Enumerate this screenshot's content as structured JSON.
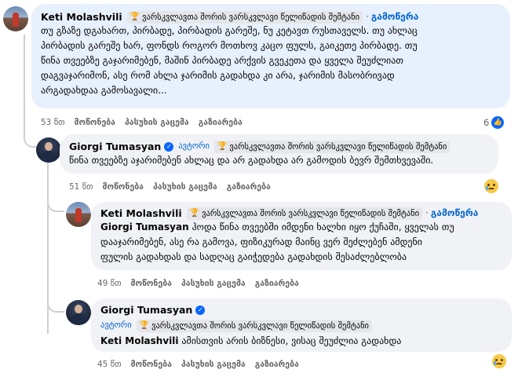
{
  "comments": [
    {
      "author": "Keti Molashvili",
      "badge": "ვარსკვლავთა შორის ვარსკვლავი წელიწადის შემტანი",
      "follow": "გამოწერა",
      "lines": [
        "თუ გზაზე დგახართ, პირბადე, პირბადის გარეშე, ნუ კეტავთ რუსთაველს. თუ ახლაც",
        "პირბადის გარეშე ხარ, ფონდს როგორ მოთხოვ კაცო ფულს, გაიკეთე პირბადე. თუ",
        "წინა თვეებზე გაჯარიმებენ, მაშინ პირბადე არქვის გვეკეთა და ყველა შეუძლიათ",
        "დაგვაჯარიმონ, ასე რომ ახლა ჯარიმის გადახდა კი არა, ჯარიმის მასობრივად",
        "არგადახდაა გამოსავალი..."
      ],
      "time": "53 წთ",
      "like": "მოწონება",
      "reply": "პასუხის გაცემა",
      "share": "გაზიარება",
      "reaction_count": "6"
    },
    {
      "author": "Giorgi Tumasyan",
      "top_fan": "ავტორი",
      "badge": "ვარსკვლავთა შორის ვარსკვლავი წელიწადის შემტანი",
      "line1": "წინა თვეებზე აჯარიმებენ ახლაც და არ გადახდა არ გამოდის ბევრ შემთხვევაში.",
      "time": "51 წთ",
      "like": "მოწონება",
      "reply": "პასუხის გაცემა",
      "share": "გაზიარება"
    },
    {
      "author": "Keti Molashvili",
      "badge": "ვარსკვლავთა შორის ვარსკვლავი წელიწადის შემტანი",
      "follow": "გამოწერა",
      "mention": "Giorgi Tumasyan",
      "line1_rest": "ჰოდა წინა თვეებში იმდენი ხალხი იყო ქუჩაში, ყველას თუ",
      "line2": "დააჯარიმებენ, ასე რა გამოვა, ფიზიკურად მაინც ვერ შეძლებენ ამდენი",
      "line3": "ფულის გადახდას და სადღაც გაიჭედება გადახდის შესაძლებლობა",
      "time": "49 წთ",
      "like": "მოწონება",
      "reply": "პასუხის გაცემა",
      "share": "გაზიარება"
    },
    {
      "author": "Giorgi Tumasyan",
      "top_fan": "ავტორი",
      "badge": "ვარსკვლავთა შორის ვარსკვლავი წელიწადის შემტანი",
      "mention": "Keti Molashvili",
      "line1_rest": "ამისთვის არის ბიზნესი, ვისაც შეუძლია გადახდა",
      "time": "45 წთ",
      "like": "მოწონება",
      "reply": "პასუხის გაცემა",
      "share": "გაზიარება"
    }
  ],
  "sep": "·",
  "trophy_glyph": "🏆",
  "like_glyph": "👍",
  "check_glyph": "✓",
  "accent": "#0064d1",
  "highlight_bg": "#e7f0fd"
}
